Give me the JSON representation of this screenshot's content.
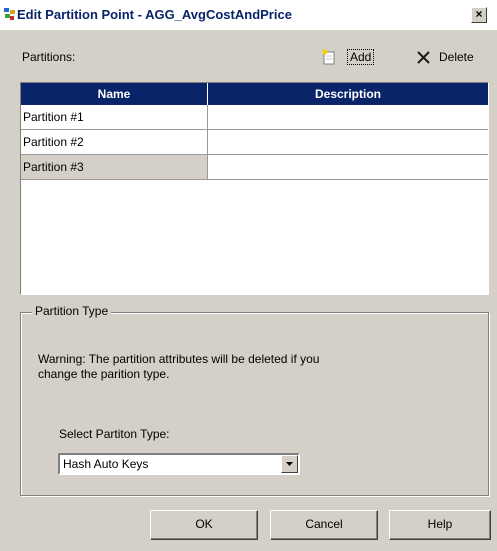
{
  "window": {
    "title": "Edit Partition Point - AGG_AvgCostAndPrice",
    "close_glyph": "×"
  },
  "toolbar": {
    "partitions_label": "Partitions:",
    "add_label": "Add",
    "delete_label": "Delete"
  },
  "grid": {
    "columns": [
      "Name",
      "Description"
    ],
    "rows": [
      {
        "name": "Partition #1",
        "description": ""
      },
      {
        "name": "Partition #2",
        "description": ""
      },
      {
        "name": "Partition #3",
        "description": ""
      }
    ],
    "selected_row": 2
  },
  "partition_type": {
    "legend": "Partition Type",
    "warning_line1": "Warning: The partition attributes will be deleted if you",
    "warning_line2": "change the parition type.",
    "select_label": "Select Partiton Type:",
    "selected_value": "Hash Auto Keys"
  },
  "buttons": {
    "ok": "OK",
    "cancel": "Cancel",
    "help": "Help"
  },
  "colors": {
    "header_bg": "#0a246a",
    "dialog_bg": "#d4d0c8",
    "delete_icon": "#1a1a1a"
  }
}
